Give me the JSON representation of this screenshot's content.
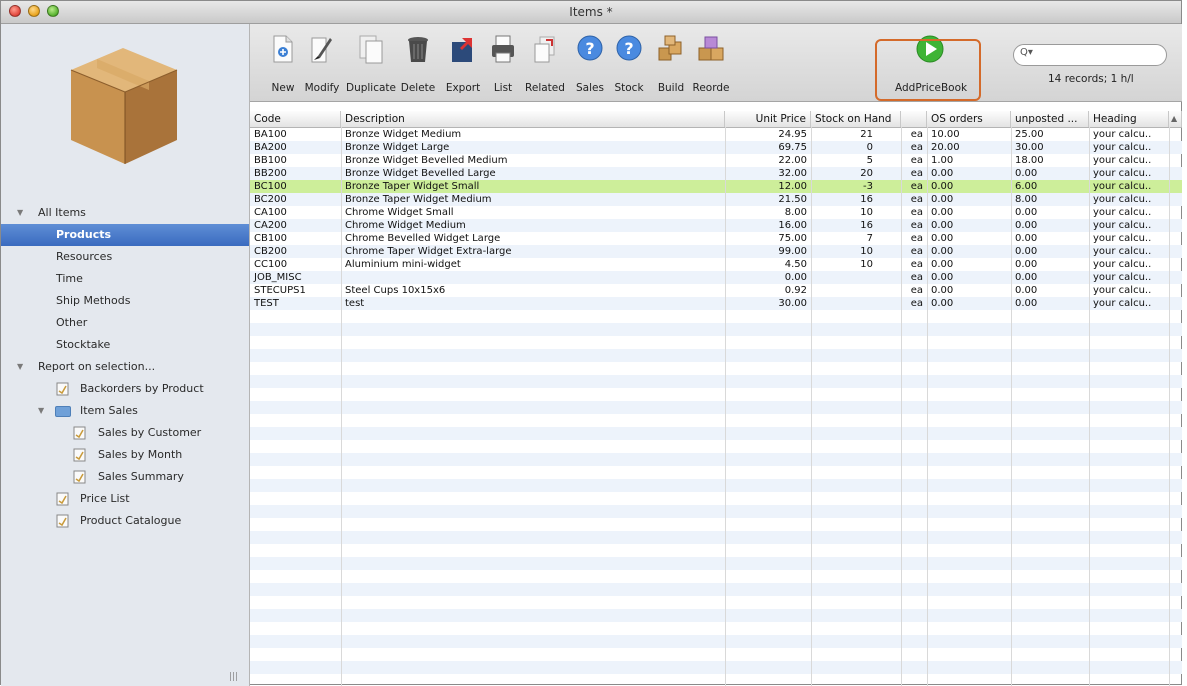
{
  "window": {
    "title": "Items *"
  },
  "toolbar": {
    "buttons": [
      {
        "label": "New",
        "icon": "new-doc-icon"
      },
      {
        "label": "Modify",
        "icon": "modify-icon"
      },
      {
        "label": "Duplicate",
        "icon": "duplicate-icon"
      },
      {
        "label": "Delete",
        "icon": "trash-icon"
      },
      {
        "label": "Export",
        "icon": "export-icon"
      },
      {
        "label": "List",
        "icon": "printer-icon"
      },
      {
        "label": "Related",
        "icon": "related-icon"
      },
      {
        "label": "Sales",
        "icon": "help-icon"
      },
      {
        "label": "Stock",
        "icon": "help-icon"
      },
      {
        "label": "Build",
        "icon": "build-icon"
      },
      {
        "label": "Reorde",
        "icon": "reorder-icon"
      },
      {
        "label": "AddPriceBook",
        "icon": "play-icon"
      }
    ],
    "search_placeholder": "",
    "records": "14 records; 1 h/l"
  },
  "sidebar": {
    "all_items": "All Items",
    "items": [
      "Products",
      "Resources",
      "Time",
      "Ship Methods",
      "Other",
      "Stocktake"
    ],
    "report_header": "Report on selection...",
    "reports": {
      "backorders": "Backorders by Product",
      "item_sales": "Item Sales",
      "sales_by_customer": "Sales by Customer",
      "sales_by_month": "Sales by Month",
      "sales_summary": "Sales Summary",
      "price_list": "Price List",
      "product_catalogue": "Product Catalogue"
    }
  },
  "table": {
    "columns": [
      "Code",
      "Description",
      "Unit Price",
      "Stock on Hand",
      "",
      "OS orders",
      "unposted ...",
      "Heading"
    ],
    "rows": [
      [
        "BA100",
        "Bronze Widget Medium",
        "24.95",
        "21",
        "ea",
        "10.00",
        "25.00",
        "your calcu.."
      ],
      [
        "BA200",
        "Bronze Widget Large",
        "69.75",
        "0",
        "ea",
        "20.00",
        "30.00",
        "your calcu.."
      ],
      [
        "BB100",
        "Bronze Widget Bevelled Medium",
        "22.00",
        "5",
        "ea",
        "1.00",
        "18.00",
        "your calcu.."
      ],
      [
        "BB200",
        "Bronze Widget Bevelled Large",
        "32.00",
        "20",
        "ea",
        "0.00",
        "0.00",
        "your calcu.."
      ],
      [
        "BC100",
        "Bronze Taper Widget Small",
        "12.00",
        "-3",
        "ea",
        "0.00",
        "6.00",
        "your calcu.."
      ],
      [
        "BC200",
        "Bronze Taper Widget Medium",
        "21.50",
        "16",
        "ea",
        "0.00",
        "8.00",
        "your calcu.."
      ],
      [
        "CA100",
        "Chrome Widget Small",
        "8.00",
        "10",
        "ea",
        "0.00",
        "0.00",
        "your calcu.."
      ],
      [
        "CA200",
        "Chrome Widget Medium",
        "16.00",
        "16",
        "ea",
        "0.00",
        "0.00",
        "your calcu.."
      ],
      [
        "CB100",
        "Chrome Bevelled Widget Large",
        "75.00",
        "7",
        "ea",
        "0.00",
        "0.00",
        "your calcu.."
      ],
      [
        "CB200",
        "Chrome Taper Widget Extra-large",
        "99.00",
        "10",
        "ea",
        "0.00",
        "0.00",
        "your calcu.."
      ],
      [
        "CC100",
        "Aluminium mini-widget",
        "4.50",
        "10",
        "ea",
        "0.00",
        "0.00",
        "your calcu.."
      ],
      [
        "JOB_MISC",
        "",
        "0.00",
        "",
        "ea",
        "0.00",
        "0.00",
        "your calcu.."
      ],
      [
        "STECUPS1",
        "Steel Cups 10x15x6",
        "0.92",
        "",
        "ea",
        "0.00",
        "0.00",
        "your calcu.."
      ],
      [
        "TEST",
        "test",
        "30.00",
        "",
        "ea",
        "0.00",
        "0.00",
        "your calcu.."
      ]
    ],
    "highlighted_row": 4,
    "highlight_color": "#cdee9a"
  }
}
